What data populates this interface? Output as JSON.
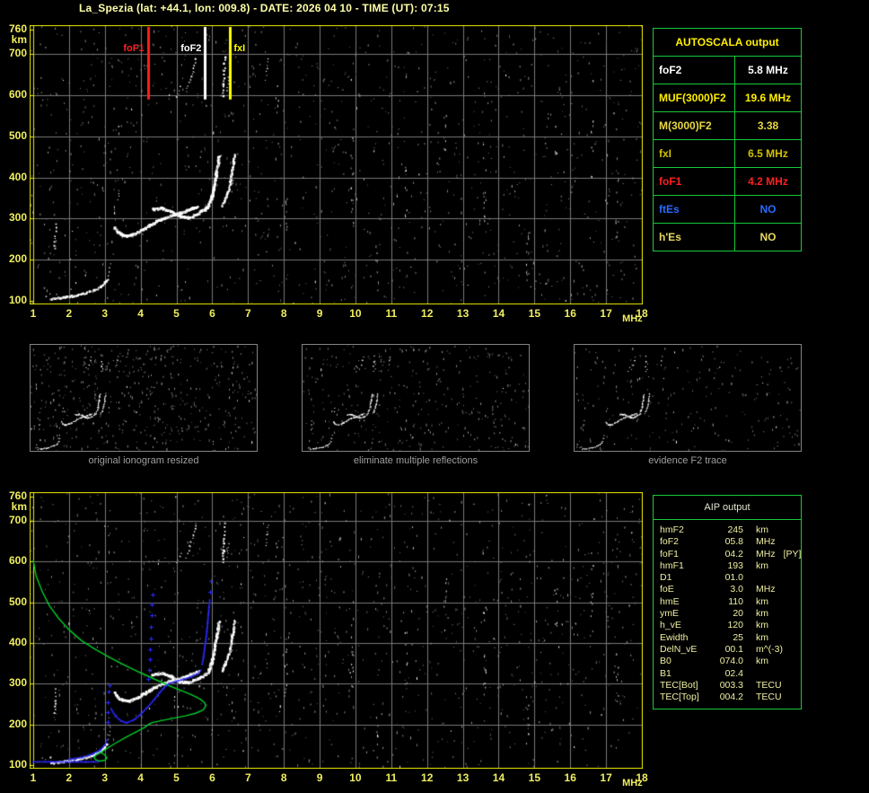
{
  "title": "La_Spezia (lat: +44.1, lon: 009.8) - DATE: 2026 04 10 - TIME (UT): 07:15",
  "colors": {
    "background": "#000000",
    "accent_yellow": "#f0ef60",
    "frame_yellow": "#e8e800",
    "grid_gray": "#787878",
    "table_green": "#17c83c",
    "trace_white": "#ffffff",
    "profile_green": "#00cc2a",
    "restored_blue": "#2a2aff",
    "caption_gray": "#9f9f9f"
  },
  "autoscala": {
    "header": "AUTOSCALA output",
    "rows": [
      {
        "label": "foF2",
        "value": "5.8 MHz",
        "color": "#ffffff"
      },
      {
        "label": "MUF(3000)F2",
        "value": "19.6 MHz",
        "color": "#ffee00"
      },
      {
        "label": "M(3000)F2",
        "value": "3.38",
        "color": "#e8d840"
      },
      {
        "label": "fxI",
        "value": "6.5 MHz",
        "color": "#cfc000"
      },
      {
        "label": "foF1",
        "value": "4.2 MHz",
        "color": "#ff2020"
      },
      {
        "label": "ftEs",
        "value": "NO",
        "color": "#2a6aff"
      },
      {
        "label": "h'Es",
        "value": "NO",
        "color": "#e8d860"
      }
    ]
  },
  "aip": {
    "header": "AIP output",
    "rows": [
      {
        "label": "hmF2",
        "value": "245",
        "unit": "km",
        "extra": ""
      },
      {
        "label": "foF2",
        "value": "05.8",
        "unit": "MHz",
        "extra": ""
      },
      {
        "label": "foF1",
        "value": "04.2",
        "unit": "MHz",
        "extra": "[PY]"
      },
      {
        "label": "hmF1",
        "value": "193",
        "unit": "km",
        "extra": ""
      },
      {
        "label": "D1",
        "value": "01.0",
        "unit": "",
        "extra": ""
      },
      {
        "label": "foE",
        "value": "3.0",
        "unit": "MHz",
        "extra": ""
      },
      {
        "label": "hmE",
        "value": "110",
        "unit": "km",
        "extra": ""
      },
      {
        "label": "ymE",
        "value": "20",
        "unit": "km",
        "extra": ""
      },
      {
        "label": "h_vE",
        "value": "120",
        "unit": "km",
        "extra": ""
      },
      {
        "label": "Ewidth",
        "value": "25",
        "unit": "km",
        "extra": ""
      },
      {
        "label": "DelN_vE",
        "value": "00.1",
        "unit": "m^(-3)",
        "extra": ""
      },
      {
        "label": "B0",
        "value": "074.0",
        "unit": "km",
        "extra": ""
      },
      {
        "label": "B1",
        "value": "02.4",
        "unit": "",
        "extra": ""
      },
      {
        "label": "TEC[Bot]",
        "value": "003.3",
        "unit": "TECU",
        "extra": ""
      },
      {
        "label": "TEC[Top]",
        "value": "004.2",
        "unit": "TECU",
        "extra": ""
      }
    ]
  },
  "panels": {
    "captions": [
      "original ionogram resized",
      "eliminate multiple reflections",
      "evidence F2 trace"
    ]
  },
  "chart_data": {
    "type": "scatter",
    "title": "La_Spezia ionogram 2026 04 10 07:15 UT",
    "x_label": "MHz",
    "y_label": "km",
    "x_range": [
      1,
      18
    ],
    "y_range": [
      100,
      760
    ],
    "x_ticks": [
      1,
      2,
      3,
      4,
      5,
      6,
      7,
      8,
      9,
      10,
      11,
      12,
      13,
      14,
      15,
      16,
      17,
      18
    ],
    "y_ticks": [
      760,
      700,
      600,
      500,
      400,
      300,
      200,
      100
    ],
    "grid": true,
    "legend": "none",
    "markers": [
      {
        "label": "foF1",
        "f": 4.2,
        "color": "#ff2020"
      },
      {
        "label": "foF2",
        "f": 5.8,
        "color": "#ffffff"
      },
      {
        "label": "fxI",
        "f": 6.5,
        "color": "#ffff00"
      }
    ],
    "trace_segments": [
      {
        "w": 2,
        "sparse": 0,
        "pts": [
          [
            1.5,
            104
          ],
          [
            1.75,
            107
          ],
          [
            2.0,
            110
          ],
          [
            2.25,
            113
          ],
          [
            2.5,
            119
          ],
          [
            2.72,
            126
          ],
          [
            2.9,
            134
          ],
          [
            3.0,
            143
          ],
          [
            3.07,
            152
          ]
        ]
      },
      {
        "w": 1.5,
        "sparse": 1,
        "pts": [
          [
            1.35,
            112
          ],
          [
            1.48,
            117
          ]
        ]
      },
      {
        "w": 1,
        "sparse": 1,
        "pts": [
          [
            3.1,
            152
          ],
          [
            3.13,
            172
          ],
          [
            3.16,
            192
          ]
        ]
      },
      {
        "w": 1.5,
        "sparse": 1,
        "pts": [
          [
            1.6,
            228
          ],
          [
            1.62,
            258
          ],
          [
            1.64,
            286
          ]
        ]
      },
      {
        "w": 2.5,
        "sparse": 0,
        "pts": [
          [
            3.28,
            278
          ],
          [
            3.38,
            266
          ],
          [
            3.5,
            259
          ],
          [
            3.66,
            257
          ],
          [
            3.85,
            263
          ],
          [
            4.05,
            272
          ],
          [
            4.25,
            282
          ],
          [
            4.45,
            292
          ],
          [
            4.65,
            300
          ],
          [
            4.85,
            306
          ],
          [
            5.05,
            311
          ],
          [
            5.25,
            317
          ],
          [
            5.45,
            324
          ],
          [
            5.62,
            330
          ]
        ]
      },
      {
        "w": 2.5,
        "sparse": 0,
        "pts": [
          [
            4.35,
            322
          ],
          [
            4.6,
            325
          ],
          [
            4.85,
            318
          ],
          [
            5.1,
            305
          ],
          [
            5.35,
            302
          ],
          [
            5.6,
            311
          ],
          [
            5.8,
            322
          ],
          [
            5.92,
            331
          ]
        ]
      },
      {
        "w": 2.5,
        "sparse": 0,
        "pts": [
          [
            5.9,
            332
          ],
          [
            5.99,
            350
          ],
          [
            6.05,
            370
          ],
          [
            6.09,
            392
          ],
          [
            6.13,
            414
          ],
          [
            6.17,
            434
          ],
          [
            6.2,
            452
          ]
        ]
      },
      {
        "w": 2,
        "sparse": 0,
        "pts": [
          [
            6.28,
            331
          ],
          [
            6.37,
            347
          ],
          [
            6.45,
            366
          ],
          [
            6.51,
            389
          ],
          [
            6.56,
            413
          ],
          [
            6.6,
            437
          ],
          [
            6.63,
            456
          ]
        ]
      },
      {
        "w": 1.5,
        "sparse": 1,
        "pts": [
          [
            5.28,
            610
          ],
          [
            5.38,
            638
          ],
          [
            5.48,
            666
          ],
          [
            5.54,
            688
          ]
        ]
      },
      {
        "w": 1,
        "sparse": 1,
        "pts": [
          [
            5.02,
            596
          ],
          [
            5.12,
            620
          ]
        ]
      },
      {
        "w": 2,
        "sparse": 1,
        "pts": [
          [
            6.3,
            598
          ],
          [
            6.32,
            628
          ],
          [
            6.34,
            658
          ],
          [
            6.36,
            694
          ]
        ]
      },
      {
        "w": 1,
        "sparse": 1,
        "pts": [
          [
            6.43,
            612
          ],
          [
            6.45,
            644
          ]
        ]
      },
      {
        "w": 1,
        "sparse": 1,
        "pts": [
          [
            7.5,
            638
          ],
          [
            7.53,
            666
          ],
          [
            7.56,
            690
          ]
        ]
      },
      {
        "w": 1,
        "sparse": 1,
        "pts": [
          [
            3.36,
            344
          ],
          [
            3.39,
            362
          ]
        ]
      }
    ],
    "noise_columns": [
      {
        "f": 9.9,
        "h1": 270,
        "h2": 510,
        "n": 14
      },
      {
        "f": 13.6,
        "h1": 280,
        "h2": 500,
        "n": 12
      },
      {
        "f": 16.6,
        "h1": 400,
        "h2": 640,
        "n": 10
      },
      {
        "f": 8.05,
        "h1": 270,
        "h2": 400,
        "n": 8
      },
      {
        "f": 11.4,
        "h1": 300,
        "h2": 430,
        "n": 8
      },
      {
        "f": 14.8,
        "h1": 150,
        "h2": 270,
        "n": 8
      },
      {
        "f": 6.55,
        "h1": 360,
        "h2": 430,
        "n": 6
      },
      {
        "f": 12.5,
        "h1": 430,
        "h2": 560,
        "n": 7
      },
      {
        "f": 15.6,
        "h1": 430,
        "h2": 540,
        "n": 6
      },
      {
        "f": 10.6,
        "h1": 120,
        "h2": 220,
        "n": 6
      },
      {
        "f": 17.3,
        "h1": 240,
        "h2": 380,
        "n": 7
      },
      {
        "f": 7.8,
        "h1": 560,
        "h2": 660,
        "n": 5
      }
    ],
    "green_profile": [
      [
        1.0,
        604
      ],
      [
        1.08,
        565
      ],
      [
        1.25,
        527
      ],
      [
        1.45,
        492
      ],
      [
        1.7,
        462
      ],
      [
        2.0,
        433
      ],
      [
        2.35,
        406
      ],
      [
        2.75,
        384
      ],
      [
        3.15,
        364
      ],
      [
        3.55,
        346
      ],
      [
        3.95,
        329
      ],
      [
        4.35,
        313
      ],
      [
        4.75,
        297
      ],
      [
        5.15,
        283
      ],
      [
        5.45,
        272
      ],
      [
        5.65,
        263
      ],
      [
        5.78,
        254
      ],
      [
        5.82,
        246
      ],
      [
        5.75,
        236
      ],
      [
        5.55,
        228
      ],
      [
        5.25,
        221
      ],
      [
        4.9,
        215
      ],
      [
        4.55,
        209
      ],
      [
        4.3,
        204
      ],
      [
        4.2,
        199
      ],
      [
        4.12,
        193
      ],
      [
        3.88,
        182
      ],
      [
        3.58,
        168
      ],
      [
        3.28,
        153
      ],
      [
        3.06,
        141
      ],
      [
        2.9,
        132
      ],
      [
        2.76,
        125
      ],
      [
        2.7,
        119
      ],
      [
        2.75,
        113
      ],
      [
        2.87,
        110
      ],
      [
        3.0,
        112
      ],
      [
        3.06,
        118
      ],
      [
        2.99,
        126
      ],
      [
        2.9,
        130
      ]
    ],
    "blue_overlay": {
      "dot_segments": [
        [
          [
            1.0,
            108
          ],
          [
            2.8,
            108
          ]
        ],
        [
          [
            2.0,
            114
          ],
          [
            2.35,
            119
          ],
          [
            2.65,
            127
          ],
          [
            2.87,
            137
          ],
          [
            3.0,
            149
          ],
          [
            3.06,
            161
          ]
        ],
        [
          [
            3.18,
            238
          ],
          [
            3.3,
            220
          ],
          [
            3.45,
            209
          ],
          [
            3.6,
            204
          ],
          [
            3.78,
            210
          ],
          [
            3.98,
            223
          ],
          [
            4.18,
            241
          ],
          [
            4.38,
            261
          ],
          [
            4.52,
            277
          ],
          [
            4.66,
            291
          ],
          [
            4.8,
            301
          ],
          [
            5.0,
            306
          ],
          [
            5.2,
            311
          ],
          [
            5.42,
            317
          ],
          [
            5.58,
            324
          ],
          [
            5.68,
            333
          ]
        ],
        [
          [
            5.72,
            348
          ],
          [
            5.76,
            368
          ],
          [
            5.79,
            388
          ],
          [
            5.82,
            408
          ],
          [
            5.85,
            428
          ],
          [
            5.87,
            448
          ],
          [
            5.89,
            468
          ],
          [
            5.91,
            488
          ],
          [
            5.93,
            505
          ]
        ]
      ],
      "cross_segments": [
        [
          [
            3.08,
            205
          ],
          [
            3.08,
            230
          ],
          [
            3.09,
            255
          ],
          [
            3.1,
            280
          ]
        ],
        [
          [
            4.22,
            312
          ],
          [
            4.24,
            335
          ],
          [
            4.26,
            360
          ],
          [
            4.27,
            385
          ],
          [
            4.28,
            412
          ],
          [
            4.29,
            440
          ],
          [
            4.3,
            468
          ],
          [
            4.31,
            495
          ],
          [
            4.33,
            520
          ]
        ],
        [
          [
            3.14,
            297
          ],
          [
            5.95,
            525
          ],
          [
            5.97,
            552
          ]
        ]
      ]
    }
  }
}
